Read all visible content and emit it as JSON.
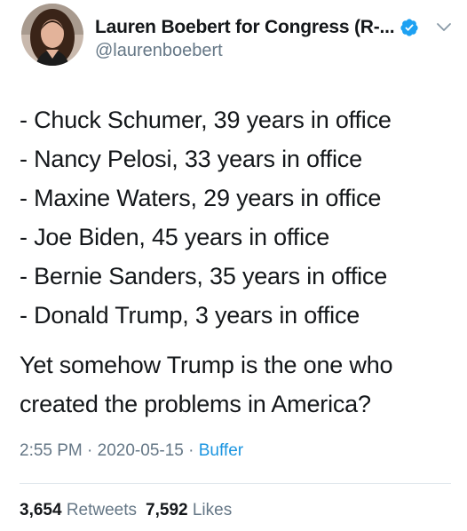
{
  "author": {
    "display_name": "Lauren Boebert for Congress (R-...",
    "handle": "@laurenboebert",
    "verified_icon": "verified-badge-icon",
    "avatar_icon": "profile-photo"
  },
  "tweet": {
    "lines": [
      "- Chuck Schumer, 39 years in office",
      "- Nancy Pelosi, 33 years in office",
      "- Maxine Waters, 29 years in office",
      "- Joe Biden, 45 years in office",
      "- Bernie Sanders, 35 years in office",
      "- Donald Trump, 3 years in office"
    ],
    "closing": "Yet somehow  Trump is the one who created the problems in America?"
  },
  "meta": {
    "time": "2:55 PM",
    "separator": " · ",
    "date": "2020-05-15",
    "source": "Buffer"
  },
  "stats": {
    "retweets_count": "3,654",
    "retweets_label": "Retweets",
    "likes_count": "7,592",
    "likes_label": "Likes"
  },
  "colors": {
    "text": "#14171a",
    "secondary": "#657786",
    "accent": "#1b95e0",
    "divider": "#e1e8ed"
  }
}
